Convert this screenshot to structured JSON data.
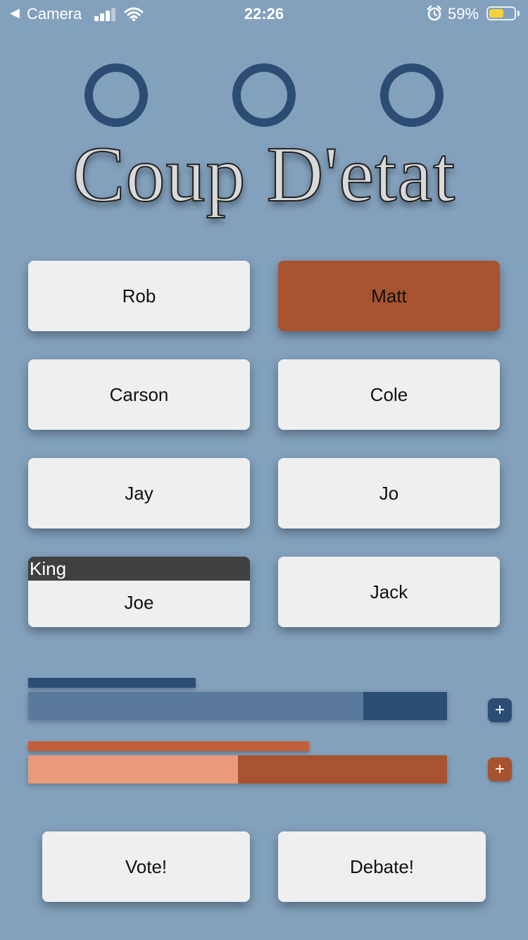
{
  "status_bar": {
    "back_arrow": "◀",
    "back_app": "Camera",
    "time": "22:26",
    "alarm_icon": "alarm-clock-icon",
    "battery_percent": "59%",
    "battery_level": 0.59,
    "battery_color": "#f7d23a"
  },
  "title": "Coup D'etat",
  "players": [
    {
      "name": "Rob",
      "selected": false,
      "role": ""
    },
    {
      "name": "Matt",
      "selected": true,
      "role": ""
    },
    {
      "name": "Carson",
      "selected": false,
      "role": ""
    },
    {
      "name": "Cole",
      "selected": false,
      "role": ""
    },
    {
      "name": "Jay",
      "selected": false,
      "role": ""
    },
    {
      "name": "Jo",
      "selected": false,
      "role": ""
    },
    {
      "name": "Joe",
      "selected": false,
      "role": "King"
    },
    {
      "name": "Jack",
      "selected": false,
      "role": ""
    }
  ],
  "meters": {
    "blue": {
      "small_fraction": 0.4,
      "fill_fraction": 0.8,
      "track_color": "#2c4d73",
      "fill_color": "#5a7a9b",
      "small_color": "#2c4d73",
      "button_label": "+"
    },
    "orange": {
      "small_fraction": 0.67,
      "fill_fraction": 0.5,
      "track_color": "#a85330",
      "fill_color": "#e89a7a",
      "small_color": "#c0603a",
      "button_label": "+"
    }
  },
  "actions": {
    "vote_label": "Vote!",
    "debate_label": "Debate!"
  },
  "colors": {
    "background": "#83a1bd",
    "accent_blue": "#2c4d73",
    "accent_orange": "#a85330"
  }
}
